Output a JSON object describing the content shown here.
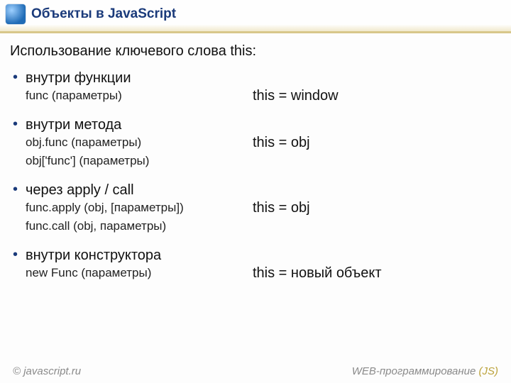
{
  "header": {
    "title": "Объекты в JavaScript",
    "logoName": "globe-logo"
  },
  "intro": "Использование ключевого слова this:",
  "cases": [
    {
      "head": "внутри функции",
      "lines": [
        "func (параметры)"
      ],
      "result": "this = window"
    },
    {
      "head": "внутри метода",
      "lines": [
        "obj.func (параметры)",
        "obj['func'] (параметры)"
      ],
      "result": "this = obj"
    },
    {
      "head": "через apply / call",
      "lines": [
        "func.apply (obj, [параметры])",
        "func.call (obj, параметры)"
      ],
      "result": "this = obj"
    },
    {
      "head": "внутри конструктора",
      "lines": [
        "new Func (параметры)"
      ],
      "result": "this = новый объект"
    }
  ],
  "footer": {
    "left": "© javascript.ru",
    "rightPrefix": "WEB-программирование ",
    "rightAccent": "(JS)"
  }
}
